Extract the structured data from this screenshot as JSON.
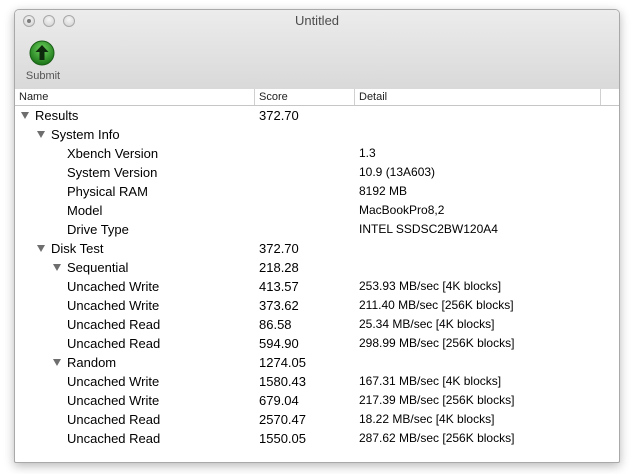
{
  "window": {
    "title": "Untitled"
  },
  "toolbar": {
    "submit_label": "Submit"
  },
  "columns": {
    "name": "Name",
    "score": "Score",
    "detail": "Detail"
  },
  "rows": [
    {
      "name": "Results",
      "score": "372.70",
      "detail": "",
      "level": 0,
      "expanded": true
    },
    {
      "name": "System Info",
      "score": "",
      "detail": "",
      "level": 1,
      "expanded": true
    },
    {
      "name": "Xbench Version",
      "score": "",
      "detail": "1.3",
      "level": 2
    },
    {
      "name": "System Version",
      "score": "",
      "detail": "10.9 (13A603)",
      "level": 2
    },
    {
      "name": "Physical RAM",
      "score": "",
      "detail": "8192 MB",
      "level": 2
    },
    {
      "name": "Model",
      "score": "",
      "detail": "MacBookPro8,2",
      "level": 2
    },
    {
      "name": "Drive Type",
      "score": "",
      "detail": "INTEL SSDSC2BW120A4",
      "level": 2
    },
    {
      "name": "Disk Test",
      "score": "372.70",
      "detail": "",
      "level": 1,
      "expanded": true
    },
    {
      "name": "Sequential",
      "score": "218.28",
      "detail": "",
      "level": 2,
      "expanded": true
    },
    {
      "name": "Uncached Write",
      "score": "413.57",
      "detail": "253.93 MB/sec [4K blocks]",
      "level": 3
    },
    {
      "name": "Uncached Write",
      "score": "373.62",
      "detail": "211.40 MB/sec [256K blocks]",
      "level": 3
    },
    {
      "name": "Uncached Read",
      "score": "86.58",
      "detail": "25.34 MB/sec [4K blocks]",
      "level": 3
    },
    {
      "name": "Uncached Read",
      "score": "594.90",
      "detail": "298.99 MB/sec [256K blocks]",
      "level": 3
    },
    {
      "name": "Random",
      "score": "1274.05",
      "detail": "",
      "level": 2,
      "expanded": true
    },
    {
      "name": "Uncached Write",
      "score": "1580.43",
      "detail": "167.31 MB/sec [4K blocks]",
      "level": 3
    },
    {
      "name": "Uncached Write",
      "score": "679.04",
      "detail": "217.39 MB/sec [256K blocks]",
      "level": 3
    },
    {
      "name": "Uncached Read",
      "score": "2570.47",
      "detail": "18.22 MB/sec [4K blocks]",
      "level": 3
    },
    {
      "name": "Uncached Read",
      "score": "1550.05",
      "detail": "287.62 MB/sec [256K blocks]",
      "level": 3
    }
  ],
  "colors": {
    "submit_green": "#2e9a2a",
    "triangle": "#6e6e6e"
  }
}
